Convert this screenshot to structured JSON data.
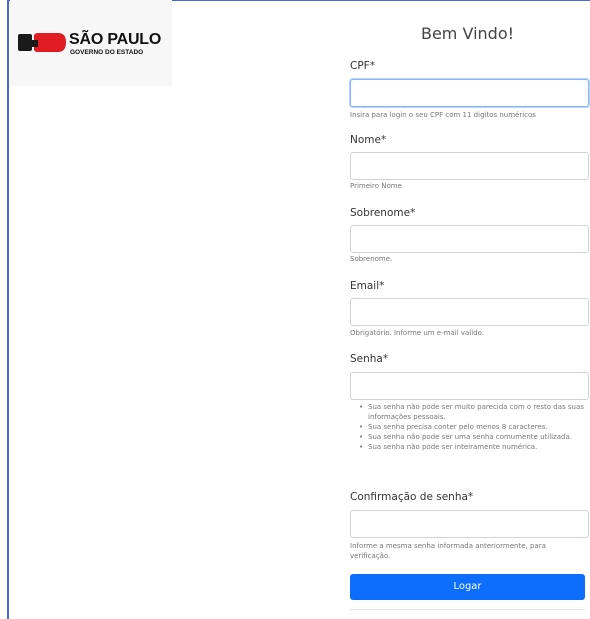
{
  "brand": {
    "title": "SÃO PAULO",
    "subtitle": "GOVERNO DO ESTADO",
    "colors": {
      "mark_dark": "#1a1a1a",
      "mark_red": "#e01b22"
    }
  },
  "form": {
    "heading": "Bem Vindo!",
    "fields": {
      "cpf": {
        "label": "CPF*",
        "value": "",
        "help": "Insira para login o seu CPF com 11 digitos numéricos"
      },
      "nome": {
        "label": "Nome*",
        "value": "",
        "help": "Primeiro Nome"
      },
      "sobrenome": {
        "label": "Sobrenome*",
        "value": "",
        "help": "Sobrenome."
      },
      "email": {
        "label": "Email*",
        "value": "",
        "help": "Obrigatório. Informe um e-mail valido."
      },
      "senha": {
        "label": "Senha*",
        "value": "",
        "rules": [
          "Sua senha não pode ser muito parecida com o resto das suas informações pessoais.",
          "Sua senha precisa conter pelo menos 8 caracteres.",
          "Sua senha não pode ser uma senha comumente utilizada.",
          "Sua senha não pode ser inteiramente numérica."
        ]
      },
      "confirmacao": {
        "label": "Confirmação de senha*",
        "value": "",
        "help": "Informe a mesma senha informada anteriormente, para verificação."
      }
    },
    "submit_label": "Logar",
    "colors": {
      "primary": "#0d6efd",
      "focus_border": "#86b7fe"
    }
  }
}
